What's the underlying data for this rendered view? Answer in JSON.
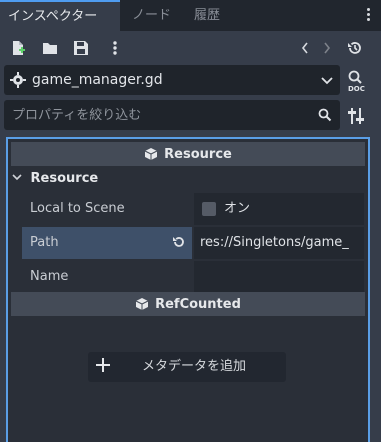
{
  "tabs": [
    {
      "label": "インスペクター",
      "active": true
    },
    {
      "label": "ノード",
      "active": false
    },
    {
      "label": "履歴",
      "active": false
    }
  ],
  "toolbar": {
    "icons": [
      "new-resource-icon",
      "open-folder-icon",
      "save-icon",
      "more-vertical-icon",
      "back-icon",
      "forward-icon",
      "history-icon"
    ]
  },
  "object_selector": {
    "value": "game_manager.gd",
    "doc_label": "DOC"
  },
  "filter": {
    "placeholder": "プロパティを絞り込む"
  },
  "sections": {
    "resource_header": "Resource",
    "resource_category": "Resource",
    "refcounted_header": "RefCounted"
  },
  "properties": [
    {
      "label": "Local to Scene",
      "value": "オン",
      "checked": false
    },
    {
      "label": "Path",
      "value": "res://Singletons/game_"
    },
    {
      "label": "Name",
      "value": ""
    }
  ],
  "add_metadata_label": "メタデータを追加",
  "colors": {
    "accent": "#4f9cf0",
    "panel_bg": "#363d4a",
    "highlight_row": "#3e5069"
  }
}
